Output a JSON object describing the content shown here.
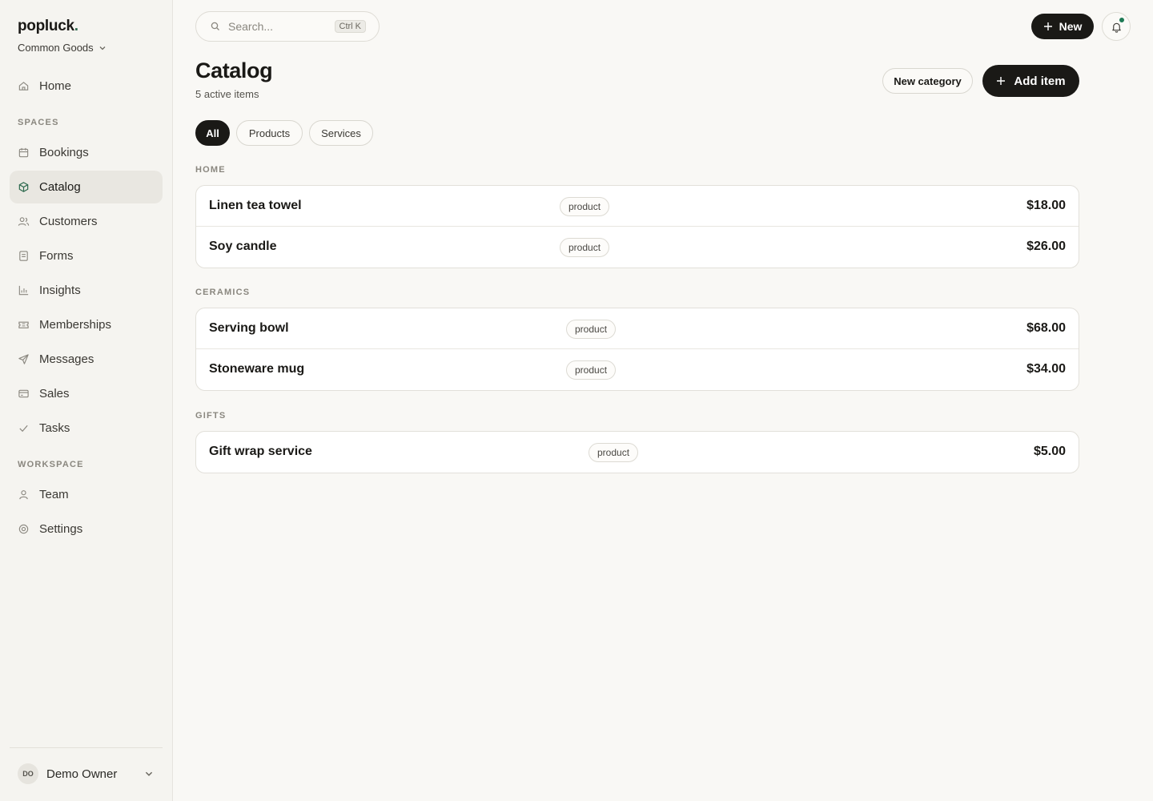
{
  "brand": {
    "name": "popluck",
    "dot": "."
  },
  "workspace": {
    "name": "Common Goods"
  },
  "nav": {
    "home": "Home",
    "spaces_label": "SPACES",
    "spaces": [
      {
        "label": "Bookings",
        "icon": "calendar-icon"
      },
      {
        "label": "Catalog",
        "icon": "box-icon",
        "active": true
      },
      {
        "label": "Customers",
        "icon": "users-icon"
      },
      {
        "label": "Forms",
        "icon": "form-icon"
      },
      {
        "label": "Insights",
        "icon": "chart-icon"
      },
      {
        "label": "Memberships",
        "icon": "ticket-icon"
      },
      {
        "label": "Messages",
        "icon": "send-icon"
      },
      {
        "label": "Sales",
        "icon": "card-icon"
      },
      {
        "label": "Tasks",
        "icon": "check-icon"
      }
    ],
    "workspace_label": "WORKSPACE",
    "workspace_items": [
      {
        "label": "Team",
        "icon": "user-icon"
      },
      {
        "label": "Settings",
        "icon": "gear-icon"
      }
    ]
  },
  "user": {
    "initials": "DO",
    "name": "Demo Owner"
  },
  "topbar": {
    "search_placeholder": "Search...",
    "shortcut": "Ctrl K",
    "new_label": "New"
  },
  "page": {
    "title": "Catalog",
    "subtitle": "5 active items",
    "new_category_label": "New category",
    "add_item_label": "Add item"
  },
  "filters": [
    "All",
    "Products",
    "Services"
  ],
  "active_filter": "All",
  "groups": [
    {
      "label": "HOME",
      "items": [
        {
          "name": "Linen tea towel",
          "tag": "product",
          "price": "$18.00"
        },
        {
          "name": "Soy candle",
          "tag": "product",
          "price": "$26.00"
        }
      ]
    },
    {
      "label": "CERAMICS",
      "items": [
        {
          "name": "Serving bowl",
          "tag": "product",
          "price": "$68.00"
        },
        {
          "name": "Stoneware mug",
          "tag": "product",
          "price": "$34.00"
        }
      ]
    },
    {
      "label": "GIFTS",
      "items": [
        {
          "name": "Gift wrap service",
          "tag": "product",
          "price": "$5.00"
        }
      ]
    }
  ],
  "colors": {
    "accent": "#1a1916",
    "notification_dot": "#1e7a55",
    "active_nav_bg": "#e9e7e1"
  }
}
